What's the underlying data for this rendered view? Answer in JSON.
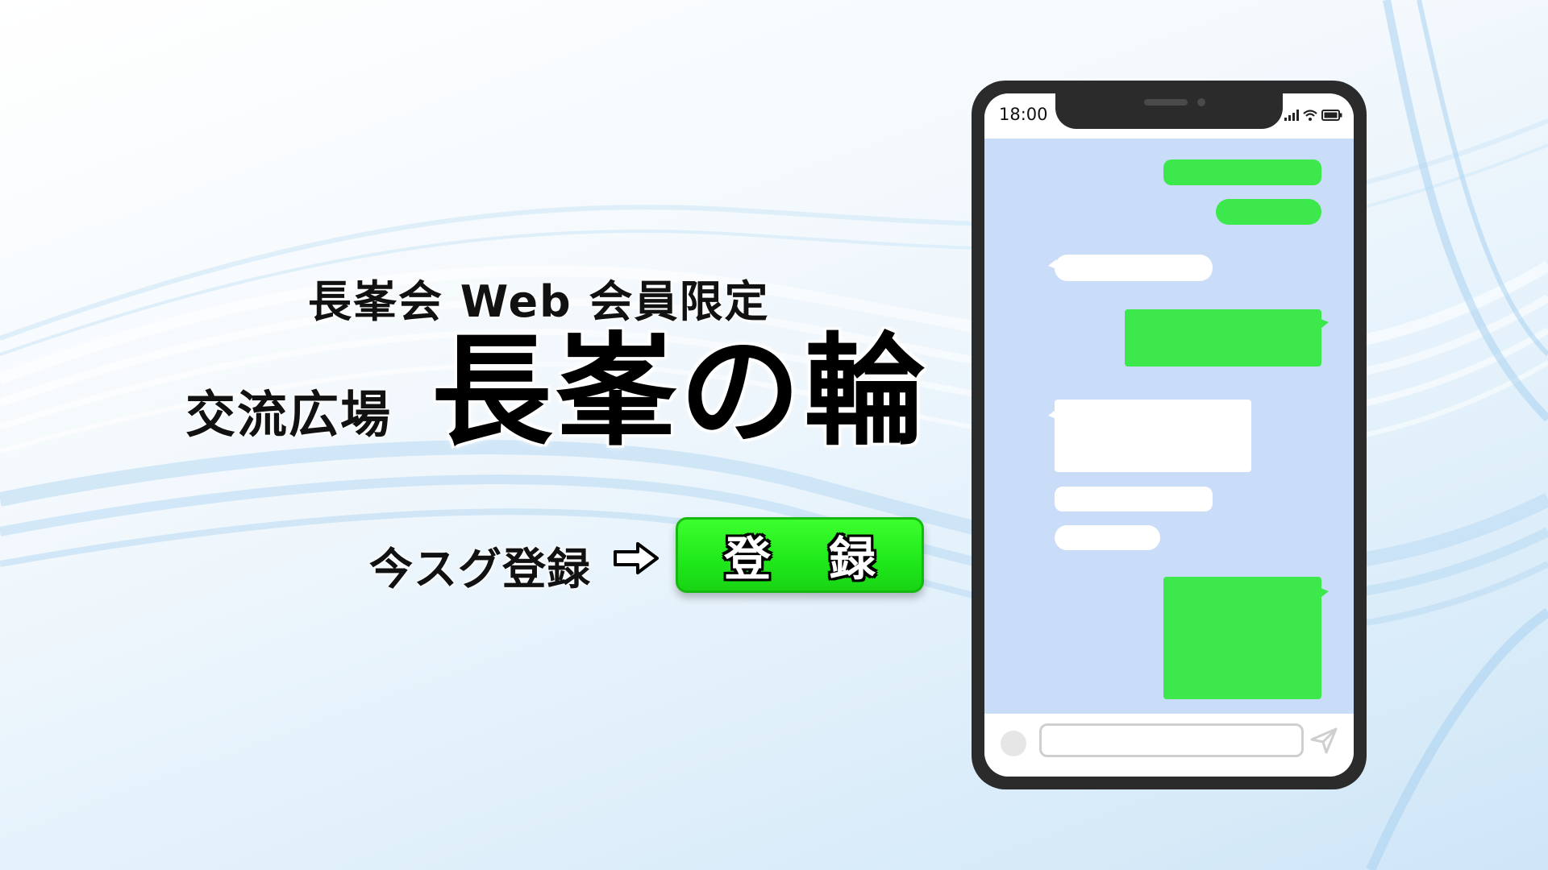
{
  "headline": {
    "subtitle": "長峯会 Web 会員限定",
    "plaza_label": "交流広場",
    "title": "長峯の輪"
  },
  "cta": {
    "text": "今スグ登録",
    "arrow_icon": "right-arrow-outline-icon",
    "button_label": "登録"
  },
  "phone": {
    "status_time": "18:00",
    "status_icons": [
      "signal-icon",
      "wifi-icon",
      "battery-icon"
    ],
    "input_placeholder": "",
    "send_icon": "send-icon"
  },
  "colors": {
    "button_green": "#1fe81a",
    "bubble_green": "#3ce84c",
    "screen_blue": "#c9dcf8",
    "phone_body": "#2b2b2b"
  }
}
